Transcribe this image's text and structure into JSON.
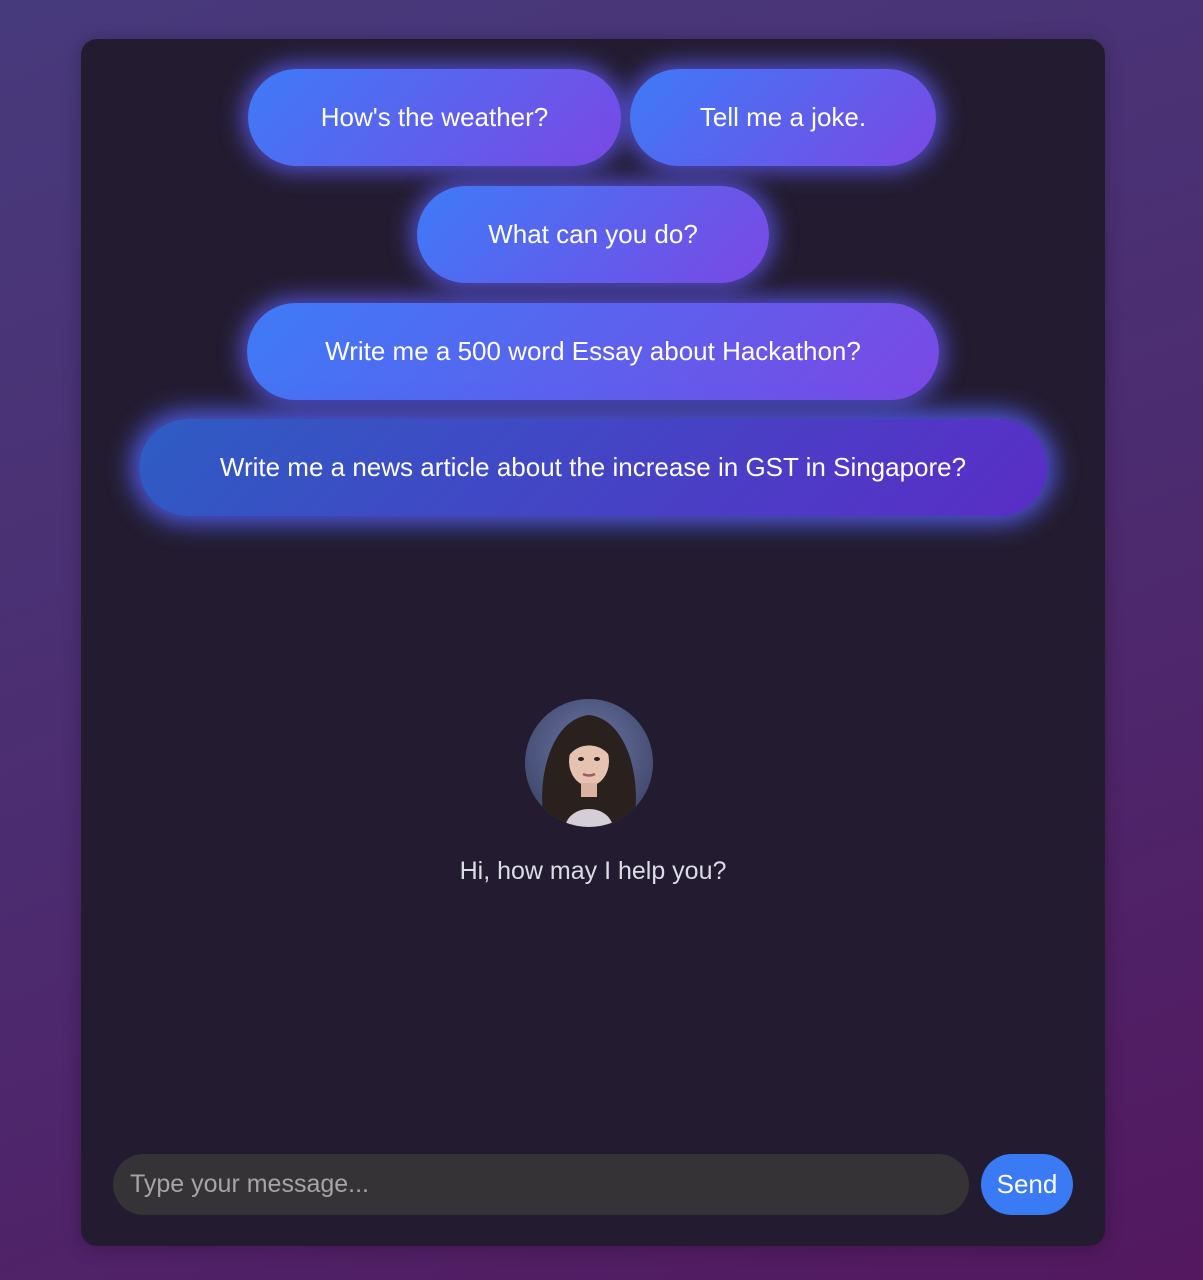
{
  "suggestions": [
    {
      "label": "How's the weather?"
    },
    {
      "label": "Tell me a joke."
    },
    {
      "label": "What can you do?"
    },
    {
      "label": "Write me a 500 word Essay about Hackathon?"
    },
    {
      "label": "Write me a news article about the increase in GST in Singapore?"
    }
  ],
  "assistant": {
    "avatar_icon": "assistant-avatar",
    "greeting": "Hi, how may I help you?"
  },
  "composer": {
    "placeholder": "Type your message...",
    "value": "",
    "send_label": "Send"
  },
  "colors": {
    "accent": "#3a7bf5",
    "pill_gradient_start": "#3d7bf7",
    "pill_gradient_end": "#7b48e4",
    "window_bg": "#231c30"
  }
}
